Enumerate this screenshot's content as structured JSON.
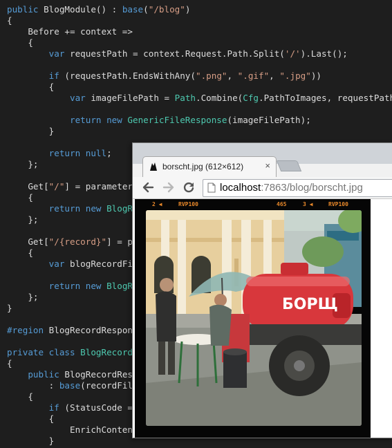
{
  "editor": {
    "lines": [
      [
        {
          "t": "public ",
          "c": "kw"
        },
        {
          "t": "BlogModule() : "
        },
        {
          "t": "base",
          "c": "kw"
        },
        {
          "t": "("
        },
        {
          "t": "\"/blog\"",
          "c": "str"
        },
        {
          "t": ")"
        }
      ],
      [
        {
          "t": "{"
        }
      ],
      [
        {
          "t": "    Before += context =>"
        }
      ],
      [
        {
          "t": "    {"
        }
      ],
      [
        {
          "t": "        "
        },
        {
          "t": "var ",
          "c": "kw"
        },
        {
          "t": "requestPath = context.Request.Path.Split("
        },
        {
          "t": "'/'",
          "c": "str"
        },
        {
          "t": ").Last();"
        }
      ],
      [],
      [
        {
          "t": "        "
        },
        {
          "t": "if ",
          "c": "kw"
        },
        {
          "t": "(requestPath.EndsWithAny("
        },
        {
          "t": "\".png\"",
          "c": "str"
        },
        {
          "t": ", "
        },
        {
          "t": "\".gif\"",
          "c": "str"
        },
        {
          "t": ", "
        },
        {
          "t": "\".jpg\"",
          "c": "str"
        },
        {
          "t": "))"
        }
      ],
      [
        {
          "t": "        {"
        }
      ],
      [
        {
          "t": "            "
        },
        {
          "t": "var ",
          "c": "kw"
        },
        {
          "t": "imageFilePath = "
        },
        {
          "t": "Path",
          "c": "typ"
        },
        {
          "t": ".Combine("
        },
        {
          "t": "Cfg",
          "c": "typ"
        },
        {
          "t": ".PathToImages, requestPath);"
        }
      ],
      [],
      [
        {
          "t": "            "
        },
        {
          "t": "return new ",
          "c": "kw"
        },
        {
          "t": "GenericFileResponse",
          "c": "typ"
        },
        {
          "t": "(imageFilePath);"
        }
      ],
      [
        {
          "t": "        }"
        }
      ],
      [],
      [
        {
          "t": "        "
        },
        {
          "t": "return null",
          "c": "kw"
        },
        {
          "t": ";"
        }
      ],
      [
        {
          "t": "    };"
        }
      ],
      [],
      [
        {
          "t": "    Get["
        },
        {
          "t": "\"/\"",
          "c": "str"
        },
        {
          "t": "] = parameters"
        }
      ],
      [
        {
          "t": "    {"
        }
      ],
      [
        {
          "t": "        "
        },
        {
          "t": "return new ",
          "c": "kw"
        },
        {
          "t": "BlogReco",
          "c": "typ"
        }
      ],
      [
        {
          "t": "    };"
        }
      ],
      [],
      [
        {
          "t": "    Get["
        },
        {
          "t": "\"/{record}\"",
          "c": "str"
        },
        {
          "t": "] = par"
        }
      ],
      [
        {
          "t": "    {"
        }
      ],
      [
        {
          "t": "        "
        },
        {
          "t": "var ",
          "c": "kw"
        },
        {
          "t": "blogRecordFile"
        }
      ],
      [],
      [
        {
          "t": "        "
        },
        {
          "t": "return new ",
          "c": "kw"
        },
        {
          "t": "BlogReco",
          "c": "typ"
        }
      ],
      [
        {
          "t": "    };"
        }
      ],
      [
        {
          "t": "}"
        }
      ],
      [],
      [
        {
          "t": "#region ",
          "c": "kw"
        },
        {
          "t": "BlogRecordResponse"
        }
      ],
      [],
      [
        {
          "t": "private class ",
          "c": "kw"
        },
        {
          "t": "BlogRecordRes",
          "c": "typ"
        }
      ],
      [
        {
          "t": "{"
        }
      ],
      [
        {
          "t": "    "
        },
        {
          "t": "public ",
          "c": "kw"
        },
        {
          "t": "BlogRecordRespo"
        }
      ],
      [
        {
          "t": "        : "
        },
        {
          "t": "base",
          "c": "kw"
        },
        {
          "t": "(recordFileF"
        }
      ],
      [
        {
          "t": "    {"
        }
      ],
      [
        {
          "t": "        "
        },
        {
          "t": "if ",
          "c": "kw"
        },
        {
          "t": "(StatusCode =="
        }
      ],
      [
        {
          "t": "        {"
        }
      ],
      [
        {
          "t": "            EnrichContentW"
        }
      ],
      [
        {
          "t": "        }"
        }
      ]
    ]
  },
  "browser": {
    "tab": {
      "title": "borscht.jpg (612×612)",
      "close_label": "×"
    },
    "url": {
      "host": "localhost",
      "rest": ":7863/blog/borscht.jpg"
    },
    "film": [
      "2 ◀",
      "RVP100",
      "465",
      "3 ◀",
      "RVP100"
    ],
    "photo": {
      "truck_sign": "БОРЩ"
    }
  },
  "colors": {
    "editor_bg": "#1e1e1e",
    "keyword": "#569cd6",
    "string": "#d69d85",
    "type": "#4ec9b0",
    "truck_red": "#d8373c"
  }
}
